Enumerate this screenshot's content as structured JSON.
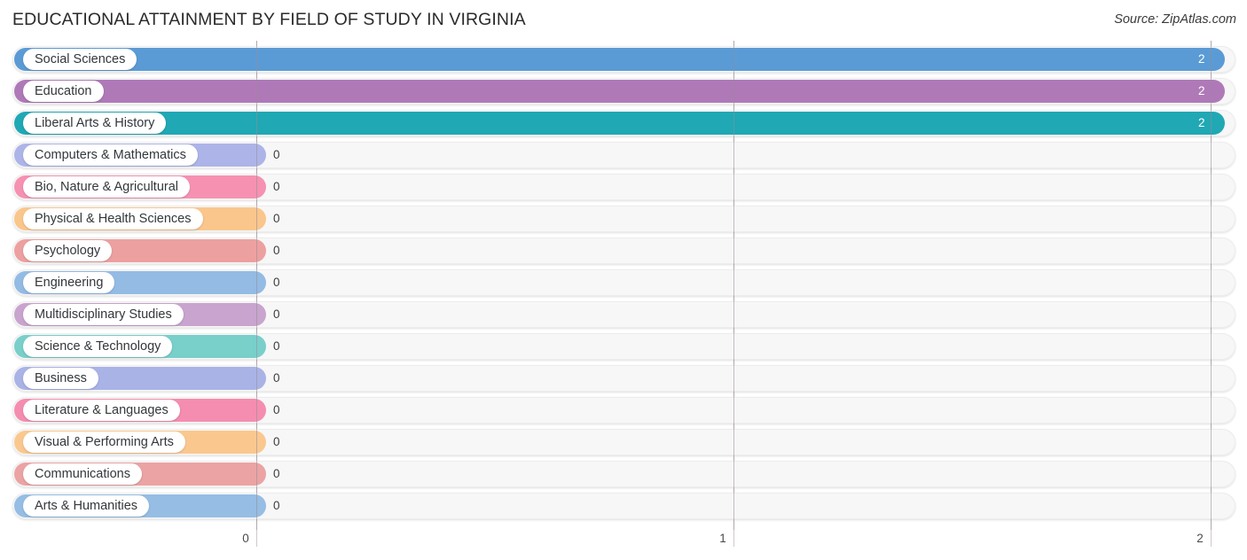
{
  "header": {
    "title": "EDUCATIONAL ATTAINMENT BY FIELD OF STUDY IN VIRGINIA",
    "source": "Source: ZipAtlas.com"
  },
  "chart_data": {
    "type": "bar",
    "orientation": "horizontal",
    "title": "EDUCATIONAL ATTAINMENT BY FIELD OF STUDY IN VIRGINIA",
    "xlabel": "",
    "ylabel": "",
    "xlim": [
      0,
      2
    ],
    "xticks": [
      "0",
      "1",
      "2"
    ],
    "xtick_values": [
      0,
      1,
      2
    ],
    "grid": true,
    "legend": "none",
    "categories": [
      "Social Sciences",
      "Education",
      "Liberal Arts & History",
      "Computers & Mathematics",
      "Bio, Nature & Agricultural",
      "Physical & Health Sciences",
      "Psychology",
      "Engineering",
      "Multidisciplinary Studies",
      "Science & Technology",
      "Business",
      "Literature & Languages",
      "Visual & Performing Arts",
      "Communications",
      "Arts & Humanities"
    ],
    "values": [
      2,
      2,
      2,
      0,
      0,
      0,
      0,
      0,
      0,
      0,
      0,
      0,
      0,
      0,
      0
    ],
    "value_labels": [
      "2",
      "2",
      "2",
      "0",
      "0",
      "0",
      "0",
      "0",
      "0",
      "0",
      "0",
      "0",
      "0",
      "0",
      "0"
    ],
    "colors": [
      "#5b9bd5",
      "#af79b8",
      "#20a8b4",
      "#adb4e8",
      "#f691b2",
      "#fac68c",
      "#eda0a0",
      "#93bbe4",
      "#c8a4ce",
      "#79cfca",
      "#a9b3e6",
      "#f58db0",
      "#fac88f",
      "#eba3a3",
      "#96bde4"
    ]
  }
}
